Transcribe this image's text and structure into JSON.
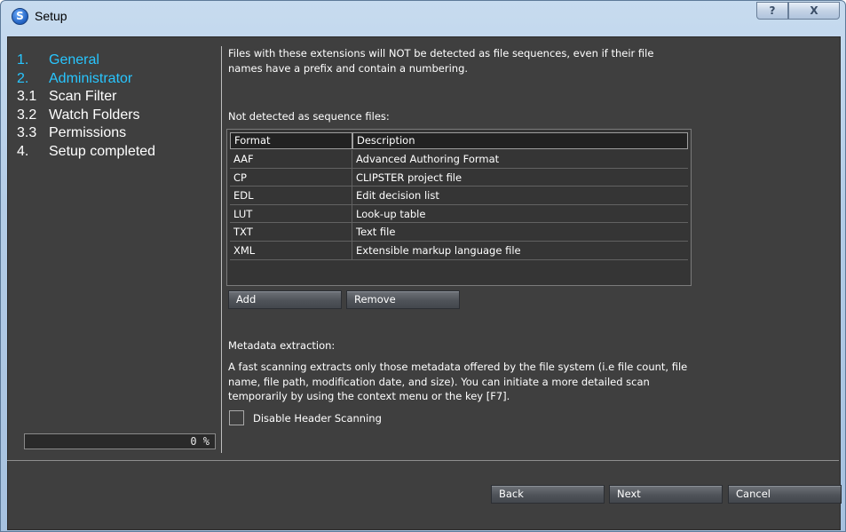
{
  "window": {
    "title": "Setup",
    "help_label": "?",
    "close_label": "X",
    "app_icon_glyph": "S"
  },
  "sidebar": {
    "steps": [
      {
        "num": "1.",
        "label": "General",
        "active": true
      },
      {
        "num": "2.",
        "label": "Administrator",
        "active": true
      },
      {
        "num": "3.1",
        "label": "Scan Filter",
        "active": false
      },
      {
        "num": "3.2",
        "label": "Watch Folders",
        "active": false
      },
      {
        "num": "3.3",
        "label": "Permissions",
        "active": false
      },
      {
        "num": "4.",
        "label": "Setup completed",
        "active": false
      }
    ],
    "progress": {
      "value": 0,
      "label": "0 %"
    }
  },
  "main": {
    "intro": "Files with these extensions will NOT be detected as file sequences, even if their file names have a prefix and contain a numbering.",
    "table_caption": "Not detected as sequence files:",
    "table": {
      "columns": [
        "Format",
        "Description"
      ],
      "rows": [
        [
          "AAF",
          "Advanced Authoring Format"
        ],
        [
          "CP",
          "CLIPSTER project file"
        ],
        [
          "EDL",
          "Edit decision list"
        ],
        [
          "LUT",
          "Look-up table"
        ],
        [
          "TXT",
          "Text file"
        ],
        [
          "XML",
          "Extensible markup language file"
        ]
      ]
    },
    "add_label": "Add",
    "remove_label": "Remove",
    "metadata_heading": "Metadata extraction:",
    "metadata_desc": "A fast scanning extracts only those metadata offered by the file system (i.e file count, file name, file path, modification date, and size). You can initiate a more detailed scan temporarily by using the context menu or the key [F7].",
    "checkbox_label": "Disable Header Scanning",
    "checkbox_checked": false
  },
  "footer": {
    "back_label": "Back",
    "next_label": "Next",
    "cancel_label": "Cancel"
  },
  "colors": {
    "active_step": "#28c6ff",
    "panel_bg": "#3f3f3f",
    "progress": "#2aa0d8"
  }
}
